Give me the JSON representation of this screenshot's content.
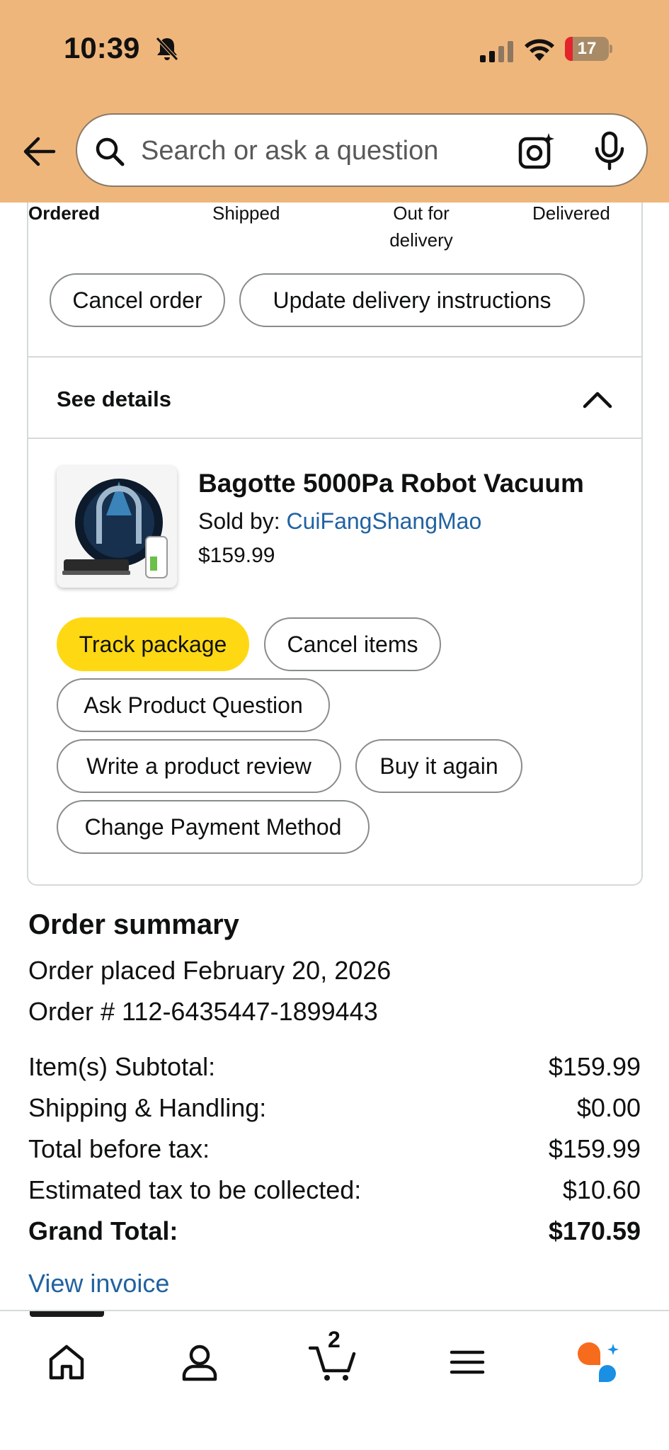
{
  "status_bar": {
    "time": "10:39",
    "battery": "17",
    "battery_level_percent": 17
  },
  "search": {
    "placeholder": "Search or ask a question"
  },
  "tracking": {
    "steps": [
      "Ordered",
      "Shipped",
      "Out for delivery",
      "Delivered"
    ],
    "current_step": "Ordered"
  },
  "order_actions": {
    "cancel_order": "Cancel order",
    "update_delivery": "Update delivery instructions"
  },
  "details": {
    "toggle_label": "See details"
  },
  "product": {
    "title": "Bagotte 5000Pa Robot Vacuum",
    "sold_by_label": "Sold by: ",
    "seller": "CuiFangShangMao",
    "price": "$159.99"
  },
  "item_actions": {
    "track_package": "Track package",
    "cancel_items": "Cancel items",
    "ask_question": "Ask Product Question",
    "write_review": "Write a product review",
    "buy_again": "Buy it again",
    "change_payment": "Change Payment Method"
  },
  "summary": {
    "title": "Order summary",
    "order_placed": "Order placed February 20, 2026",
    "order_number": "Order # 112-6435447-1899443",
    "rows": [
      {
        "label": "Item(s) Subtotal:",
        "value": "$159.99"
      },
      {
        "label": "Shipping & Handling:",
        "value": "$0.00"
      },
      {
        "label": "Total before tax:",
        "value": "$159.99"
      },
      {
        "label": "Estimated tax to be collected:",
        "value": "$10.60"
      },
      {
        "label": "Grand Total:",
        "value": "$170.59"
      }
    ],
    "view_invoice": "View invoice"
  },
  "bottom_nav": {
    "items": [
      "home-icon",
      "account-icon",
      "cart-icon",
      "menu-icon",
      "rufus-icon"
    ],
    "cart_count": "2"
  },
  "colors": {
    "header_bg": "#efb67b",
    "primary_button": "#ffd814",
    "link": "#2162a1",
    "rufus_orange": "#f76b1c",
    "rufus_blue": "#1a8fe3"
  }
}
